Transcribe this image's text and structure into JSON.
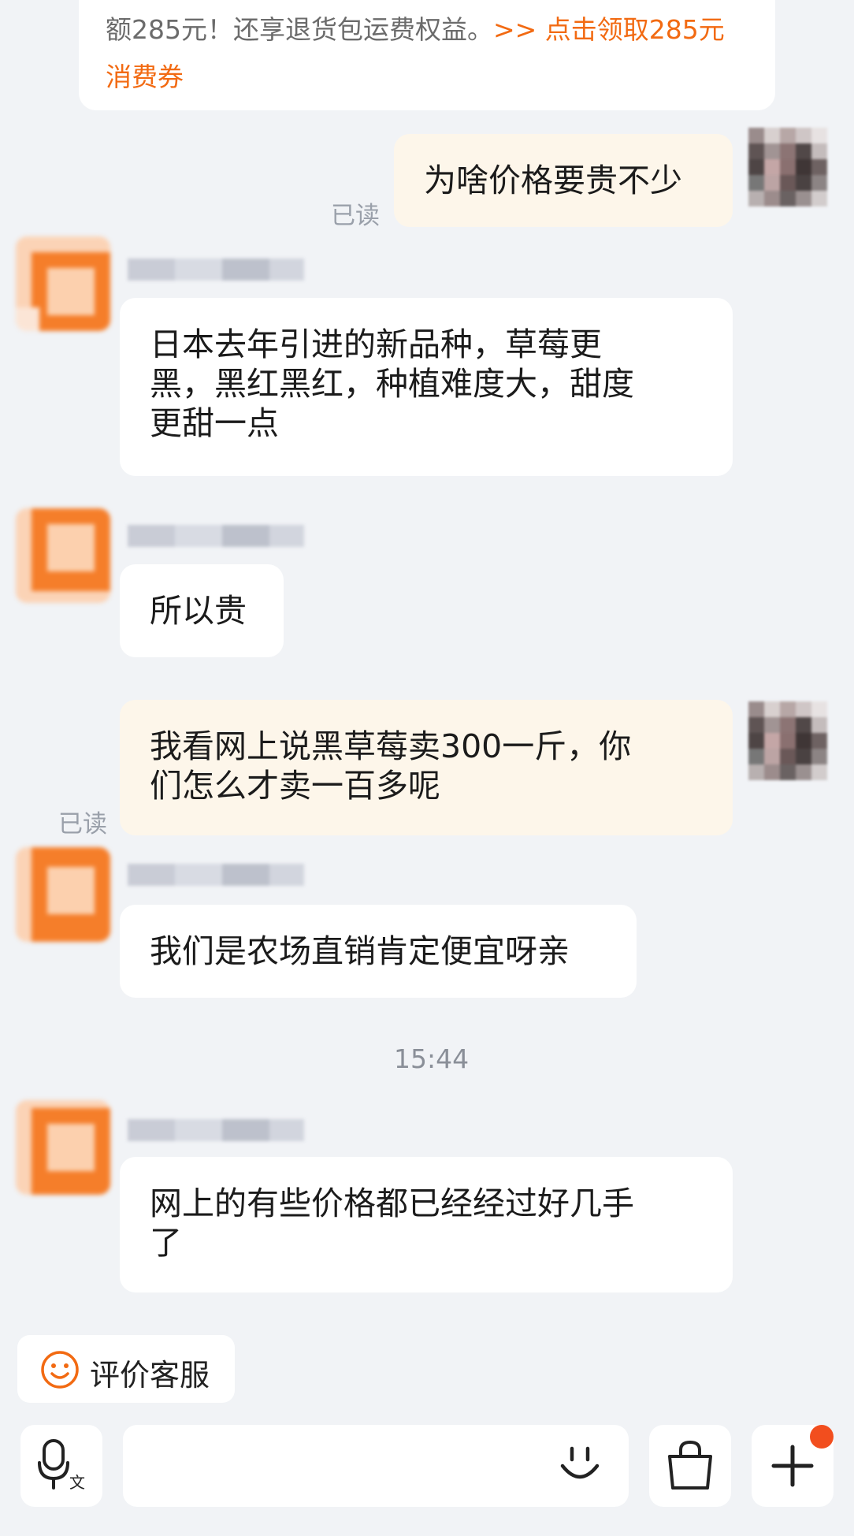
{
  "notice": {
    "text": "额285元！还享退货包运费权益。",
    "link_line1": ">> 点击领取285元",
    "link_line2": "消费券"
  },
  "messages": [
    {
      "id": "m1",
      "side": "out",
      "text": "为啥价格要贵不少",
      "read": "已读"
    },
    {
      "id": "m2",
      "side": "in",
      "lines": [
        "日本去年引进的新品种，草莓更",
        "黑，黑红黑红，种植难度大，甜度",
        "更甜一点"
      ]
    },
    {
      "id": "m3",
      "side": "in",
      "text": "所以贵"
    },
    {
      "id": "m4",
      "side": "out",
      "lines": [
        "我看网上说黑草莓卖300一斤，你",
        "们怎么才卖一百多呢"
      ],
      "read": "已读"
    },
    {
      "id": "m5",
      "side": "in",
      "text": "我们是农场直销肯定便宜呀亲"
    },
    {
      "id": "m6",
      "side": "in",
      "lines": [
        "网上的有些价格都已经经过好几手",
        "了"
      ]
    }
  ],
  "time_separator": "15:44",
  "rate_service": {
    "label": "评价客服",
    "icon": "smiley-icon"
  },
  "input_bar": {
    "voice_icon": "voice-translate-icon",
    "emoji_icon": "emoji-icon",
    "shop_icon": "shopping-bag-icon",
    "plus_icon": "plus-icon"
  },
  "colors": {
    "accent": "#f26a12",
    "background": "#f1f3f6",
    "bubble_out": "#fdf6ea",
    "bubble_in": "#ffffff",
    "badge": "#f24e1e"
  }
}
